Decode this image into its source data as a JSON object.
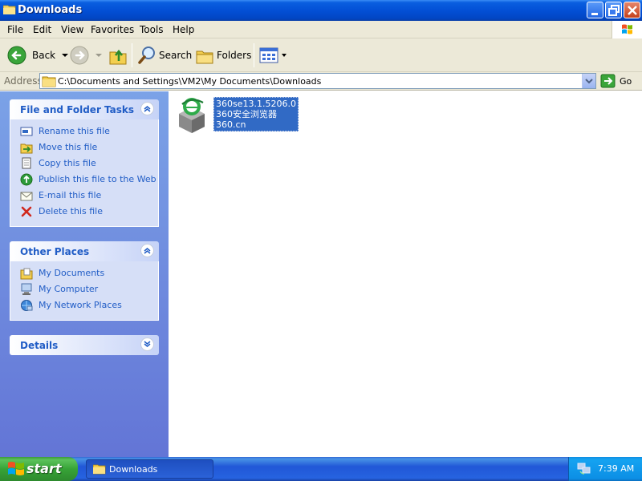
{
  "window": {
    "title": "Downloads",
    "icon": "folder-icon",
    "controls": [
      "minimize-icon",
      "restore-icon",
      "close-icon"
    ]
  },
  "menubar": {
    "items": [
      "File",
      "Edit",
      "View",
      "Favorites",
      "Tools",
      "Help"
    ]
  },
  "toolbar": {
    "back_label": "Back",
    "search_label": "Search",
    "folders_label": "Folders"
  },
  "address": {
    "label": "Address",
    "value": "C:\\Documents and Settings\\VM2\\My Documents\\Downloads",
    "go_label": "Go"
  },
  "sidebar": {
    "file_tasks": {
      "title": "File and Folder Tasks",
      "items": [
        {
          "label": "Rename this file",
          "icon": "rename-icon"
        },
        {
          "label": "Move this file",
          "icon": "move-icon"
        },
        {
          "label": "Copy this file",
          "icon": "copy-icon"
        },
        {
          "label": "Publish this file to the Web",
          "icon": "publish-web-icon"
        },
        {
          "label": "E-mail this file",
          "icon": "email-icon"
        },
        {
          "label": "Delete this file",
          "icon": "delete-icon"
        }
      ]
    },
    "other_places": {
      "title": "Other Places",
      "items": [
        {
          "label": "My Documents",
          "icon": "my-documents-icon"
        },
        {
          "label": "My Computer",
          "icon": "my-computer-icon"
        },
        {
          "label": "My Network Places",
          "icon": "network-places-icon"
        }
      ]
    },
    "details": {
      "title": "Details"
    }
  },
  "files": [
    {
      "name_lines": [
        "360se13.1.5206.0",
        "360安全浏览器",
        "360.cn"
      ],
      "icon": "360-browser-installer-icon",
      "selected": true
    }
  ],
  "taskbar": {
    "start_label": "start",
    "task_label": "Downloads",
    "clock": "7:39 AM"
  },
  "colors": {
    "titlebar": "#0350d6",
    "sidebar_link": "#215dc6",
    "selection": "#316ac5",
    "start_green": "#37a337"
  }
}
